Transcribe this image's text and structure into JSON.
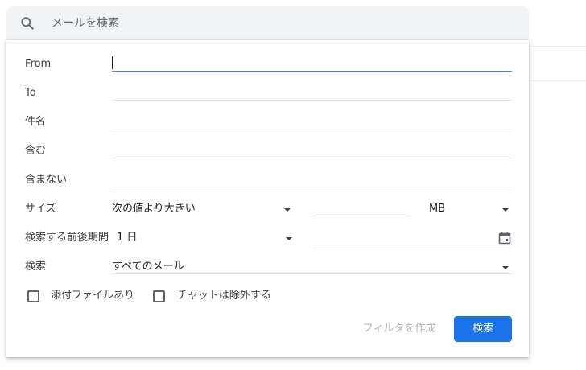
{
  "search": {
    "placeholder": "メールを検索"
  },
  "form": {
    "from_label": "From",
    "to_label": "To",
    "subject_label": "件名",
    "has_words_label": "含む",
    "doesnt_have_label": "含まない",
    "size_label": "サイズ",
    "size_comparator": "次の値より大きい",
    "size_unit": "MB",
    "date_within_label": "検索する前後期間",
    "date_within_value": "1 日",
    "search_in_label": "検索",
    "search_in_value": "すべてのメール",
    "has_attachment_label": "添付ファイルあり",
    "exclude_chats_label": "チャットは除外する"
  },
  "actions": {
    "create_filter_label": "フィルタを作成",
    "search_label": "検索"
  },
  "colors": {
    "primary": "#1a73e8",
    "active_underline": "#4285f4",
    "disabled_text": "#b0b3b8"
  },
  "icons": {
    "search": "search-icon",
    "calendar": "calendar-icon",
    "dropdown": "chevron-down-icon"
  }
}
